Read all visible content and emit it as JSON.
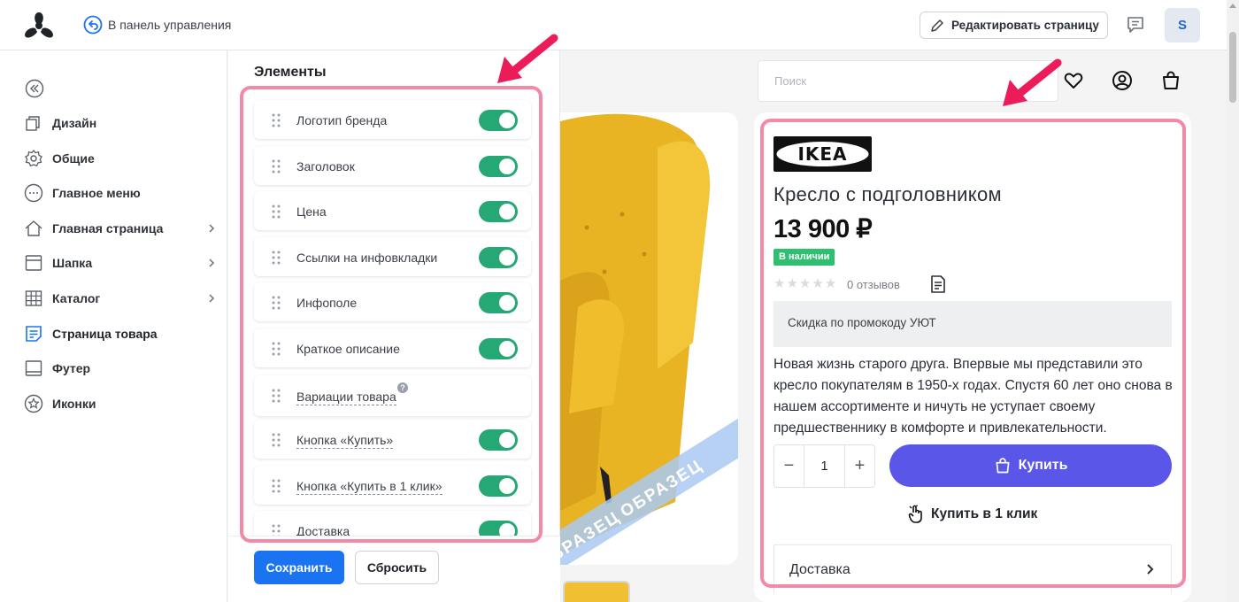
{
  "topbar": {
    "back_label": "В панель управления",
    "edit_label": "Редактировать страницу",
    "avatar_letter": "S"
  },
  "sidebar": {
    "items": [
      {
        "label": "Дизайн",
        "icon": "copy-icon"
      },
      {
        "label": "Общие",
        "icon": "gear-icon"
      },
      {
        "label": "Главное меню",
        "icon": "more-circle-icon"
      },
      {
        "label": "Главная страница",
        "icon": "home-icon",
        "has_arrow": true
      },
      {
        "label": "Шапка",
        "icon": "header-layout-icon",
        "has_arrow": true
      },
      {
        "label": "Каталог",
        "icon": "grid-icon",
        "has_arrow": true
      },
      {
        "label": "Страница товара",
        "icon": "document-list-icon",
        "active": true
      },
      {
        "label": "Футер",
        "icon": "footer-layout-icon"
      },
      {
        "label": "Иконки",
        "icon": "star-circle-icon"
      }
    ]
  },
  "elements_panel": {
    "title": "Элементы",
    "items": [
      {
        "label": "Логотип бренда",
        "enabled": true,
        "dashed": false
      },
      {
        "label": "Заголовок",
        "enabled": true,
        "dashed": false
      },
      {
        "label": "Цена",
        "enabled": true,
        "dashed": false
      },
      {
        "label": "Ссылки на инфовкладки",
        "enabled": true,
        "dashed": false
      },
      {
        "label": "Инфополе",
        "enabled": true,
        "dashed": false
      },
      {
        "label": "Краткое описание",
        "enabled": true,
        "dashed": false
      },
      {
        "label": "Вариации товара",
        "enabled": false,
        "dashed": true,
        "help": "?"
      },
      {
        "label": "Кнопка «Купить»",
        "enabled": true,
        "dashed": true
      },
      {
        "label": "Кнопка «Купить в 1 клик»",
        "enabled": true,
        "dashed": true
      },
      {
        "label": "Доставка",
        "enabled": true,
        "dashed": false
      }
    ],
    "save_label": "Сохранить",
    "reset_label": "Сбросить"
  },
  "preview": {
    "search_placeholder": "Поиск",
    "watermark": "ОБРАЗЕЦ",
    "brand_logo_text": "IKEA",
    "product_title": "Кресло с подголовником",
    "price": "13 900 ₽",
    "stock_badge": "В наличии",
    "rating_stars": 0,
    "reviews": "0 отзывов",
    "promo": "Скидка по промокоду УЮТ",
    "description": "Новая жизнь старого друга. Впервые мы представили это кресло покупателям в 1950-х годах. Спустя 60 лет оно снова в нашем ассортименте и ничуть не уступает своему предшественнику в комфорте и привлекательности.",
    "quantity": "1",
    "qty_minus": "−",
    "qty_plus": "+",
    "buy_label": "Купить",
    "one_click_label": "Купить в 1 клик",
    "delivery_label": "Доставка"
  },
  "colors": {
    "accent_blue": "#1a73f0",
    "toggle_green": "#25a873",
    "buy_purple": "#5a57e8",
    "stock_green": "#2fbf71",
    "highlight_pink": "#f28aa7",
    "arrow_red": "#ec1c5a",
    "chair_yellow": "#f0c032"
  }
}
